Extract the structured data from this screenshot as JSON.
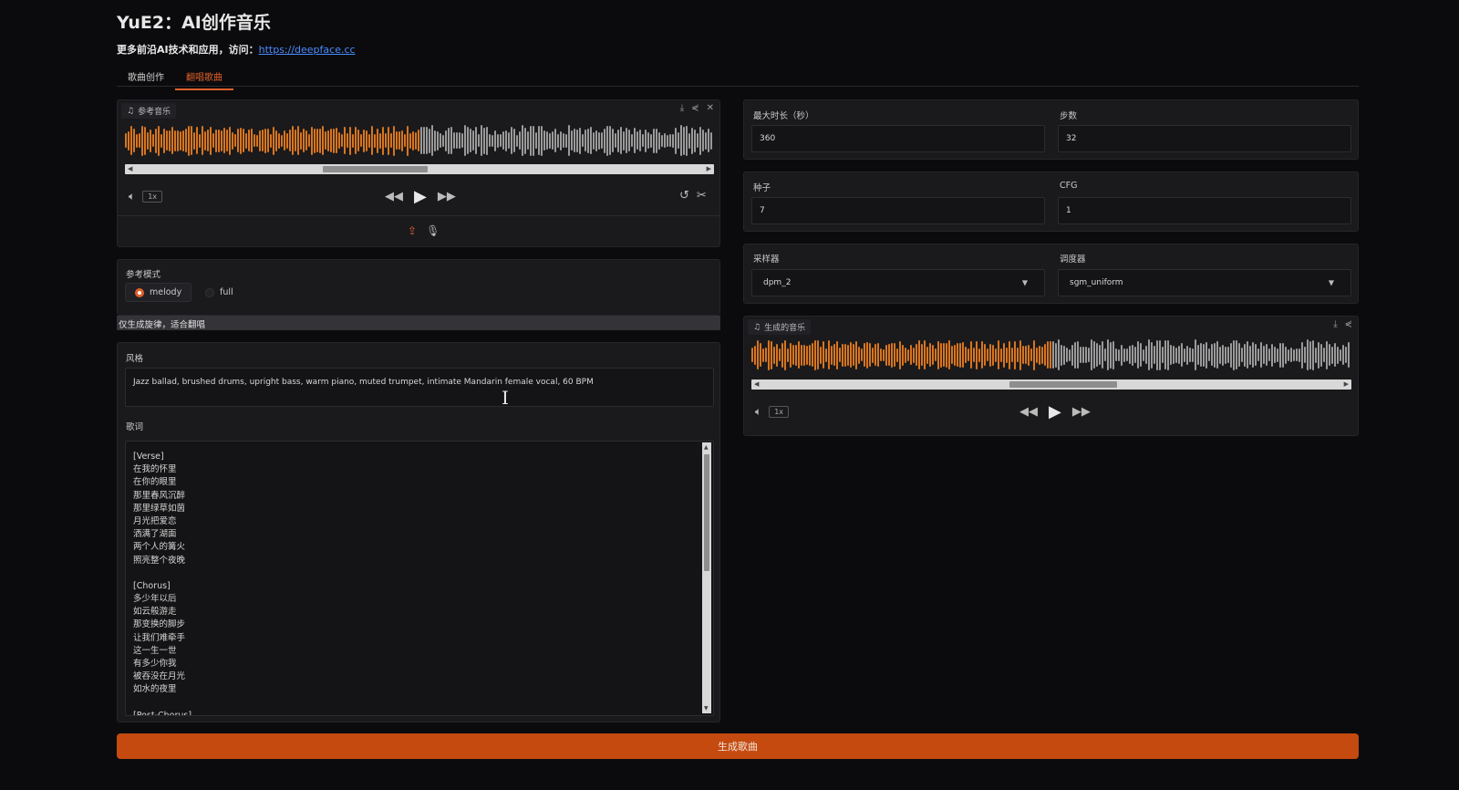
{
  "app": {
    "title": "YuE2：AI创作音乐",
    "subtitle_prefix": "更多前沿AI技术和应用，访问：",
    "subtitle_link": "https://deepface.cc"
  },
  "tabs": [
    {
      "label": "歌曲创作",
      "active": false
    },
    {
      "label": "翻唱歌曲",
      "active": true
    }
  ],
  "reference_audio": {
    "label": "参考音乐",
    "speed": "1x",
    "played_fraction": 0.5
  },
  "reference_mode": {
    "label": "参考模式",
    "options": [
      {
        "label": "melody",
        "selected": true
      },
      {
        "label": "full",
        "selected": false
      }
    ],
    "info": "仅生成旋律，适合翻唱"
  },
  "style": {
    "label": "风格",
    "value": "Jazz ballad, brushed drums, upright bass, warm piano, muted trumpet, intimate Mandarin female vocal, 60 BPM"
  },
  "lyrics": {
    "label": "歌词",
    "lines": [
      "[Verse]",
      "在我的怀里",
      "在你的眼里",
      "那里春风沉醉",
      "那里绿草如茵",
      "月光把爱恋",
      "洒满了湖面",
      "两个人的篝火",
      "照亮整个夜晚",
      "",
      "[Chorus]",
      "多少年以后",
      "如云般游走",
      "那变换的脚步",
      "让我们难牵手",
      "这一生一世",
      "有多少你我",
      "被吞没在月光",
      "如水的夜里",
      "",
      "[Post-Chorus]"
    ]
  },
  "params": {
    "max_duration": {
      "label": "最大时长（秒）",
      "value": "360"
    },
    "steps": {
      "label": "步数",
      "value": "32"
    },
    "seed": {
      "label": "种子",
      "value": "7"
    },
    "cfg": {
      "label": "CFG",
      "value": "1"
    },
    "sampler": {
      "label": "采样器",
      "value": "dpm_2"
    },
    "scheduler": {
      "label": "调度器",
      "value": "sgm_uniform"
    }
  },
  "generated_audio": {
    "label": "生成的音乐",
    "speed": "1x",
    "played_fraction": 0.5
  },
  "generate_button": "生成歌曲",
  "colors": {
    "accent": "#e0602a",
    "wave_played": "#d9751f",
    "wave_unplayed": "#9a9a9a",
    "button": "#c44a10"
  }
}
